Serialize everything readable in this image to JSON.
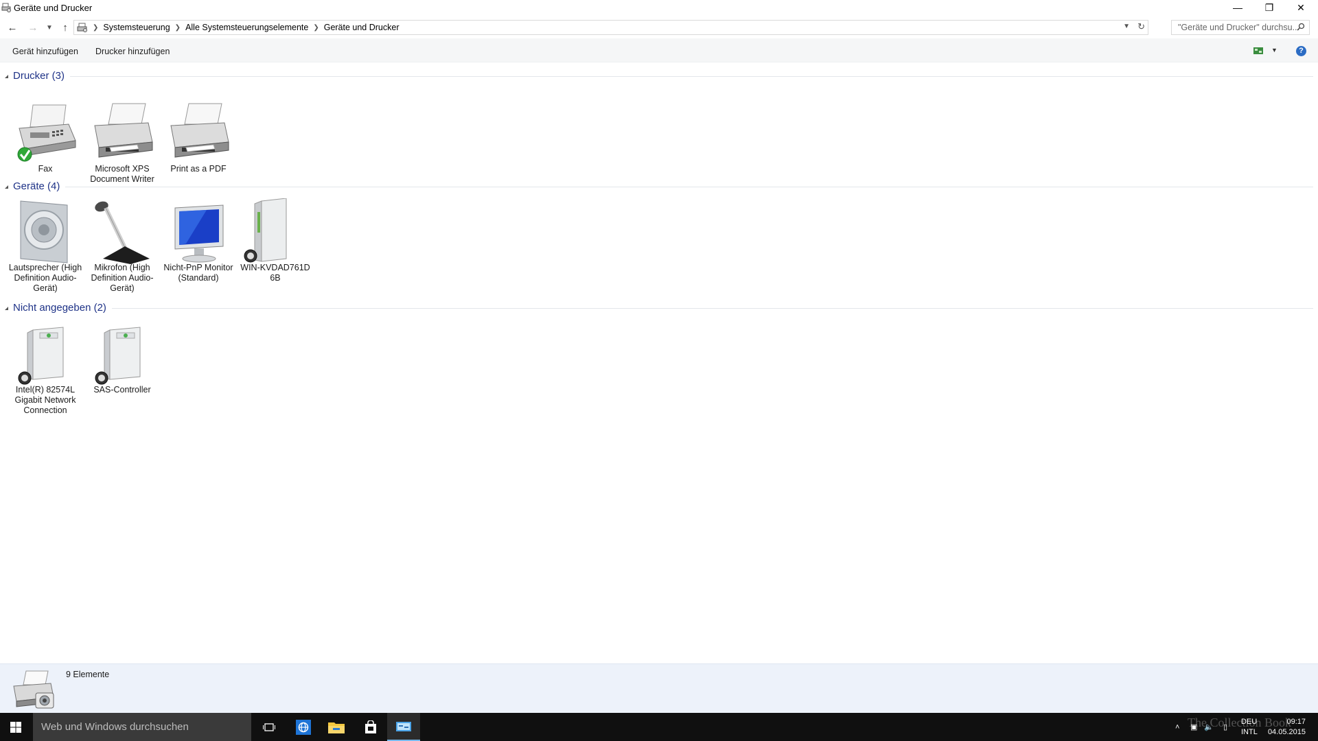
{
  "window": {
    "title": "Geräte und Drucker",
    "controls": [
      "—",
      "❐",
      "✕"
    ]
  },
  "address": {
    "crumbs": [
      "Systemsteuerung",
      "Alle Systemsteuerungselemente",
      "Geräte und Drucker"
    ],
    "search_placeholder": "\"Geräte und Drucker\" durchsu..."
  },
  "commands": {
    "add_device": "Gerät hinzufügen",
    "add_printer": "Drucker hinzufügen",
    "help": "?"
  },
  "groups": [
    {
      "title": "Drucker (3)",
      "items": [
        {
          "label": "Fax",
          "icon": "fax-icon"
        },
        {
          "label": "Microsoft XPS Document Writer",
          "icon": "printer-icon"
        },
        {
          "label": "Print as a PDF",
          "icon": "printer-icon"
        }
      ]
    },
    {
      "title": "Geräte (4)",
      "items": [
        {
          "label": "Lautsprecher (High Definition Audio-Gerät)",
          "icon": "speaker-icon"
        },
        {
          "label": "Mikrofon (High Definition Audio-Gerät)",
          "icon": "microphone-icon"
        },
        {
          "label": "Nicht-PnP Monitor (Standard)",
          "icon": "monitor-icon"
        },
        {
          "label": "WIN-KVDAD761D 6B",
          "icon": "computer-tower-icon"
        }
      ]
    },
    {
      "title": "Nicht angegeben (2)",
      "items": [
        {
          "label": "Intel(R) 82574L Gigabit Network Connection",
          "icon": "device-box-icon"
        },
        {
          "label": "SAS-Controller",
          "icon": "device-box-icon"
        }
      ]
    }
  ],
  "details": {
    "count": "9 Elemente"
  },
  "taskbar": {
    "search_placeholder": "Web und Windows durchsuchen",
    "lang_top": "DEU",
    "lang_bottom": "INTL",
    "time": "09:17",
    "date": "04.05.2015",
    "watermark": "The Collection Book"
  },
  "colors": {
    "group_title": "#1e3287",
    "command_bar": "#f5f6f7",
    "details_pane": "#edf2fa",
    "taskbar": "#101010",
    "taskbar_search": "#3a3a3a"
  }
}
